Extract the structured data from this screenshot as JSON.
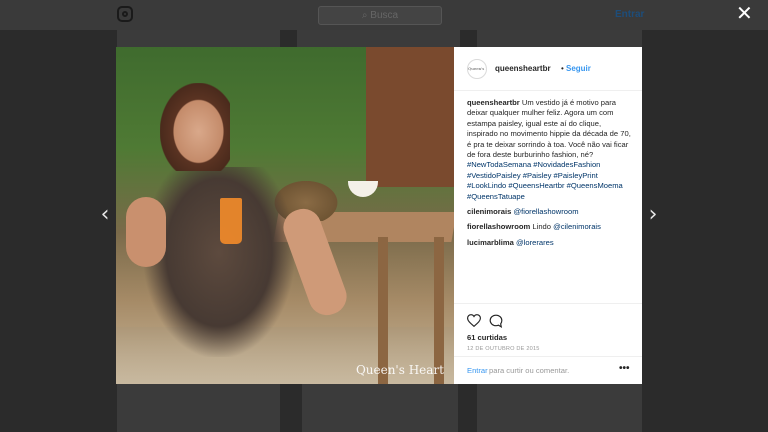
{
  "background": {
    "search_placeholder": "⌕ Busca",
    "login_label": "Entrar"
  },
  "post": {
    "watermark": "Queen's Heart",
    "avatar_text": "Queen's Heart",
    "username": "queensheartbr",
    "dot": "•",
    "follow_label": "Seguir",
    "caption_user": "queensheartbr",
    "caption_text": " Um vestido já é motivo para deixar qualquer mulher feliz. Agora um com estampa paisley, igual este aí do clique, inspirado no movimento hippie da década de 70, é pra te deixar sorrindo à toa. Você não vai ficar de fora deste burburinho fashion, né?",
    "hashtags": "#NewTodaSemana #NovidadesFashion #VestidoPaisley #Paisley #PaisleyPrint #LookLindo #QueensHeartbr #QueensMoema #QueensTatuape",
    "comments": [
      {
        "user": "cilenimorais",
        "text": "",
        "mention": "@fiorellashowroom"
      },
      {
        "user": "fiorellashowroom",
        "text": " Lindo ",
        "mention": "@cilenimorais"
      },
      {
        "user": "lucimarblima",
        "text": "",
        "mention": "@lorerares"
      }
    ],
    "likes": "61 curtidas",
    "date": "12 DE OUTUBRO DE 2015",
    "login_link": "Entrar",
    "login_rest": " para curtir ou comentar.",
    "more": "•••"
  },
  "icons": {
    "close": "✕",
    "prev": "‹",
    "next": "›"
  },
  "colors": {
    "link_blue": "#3897f0",
    "tag_blue": "#003569",
    "overlay": "#2b2b2b"
  }
}
